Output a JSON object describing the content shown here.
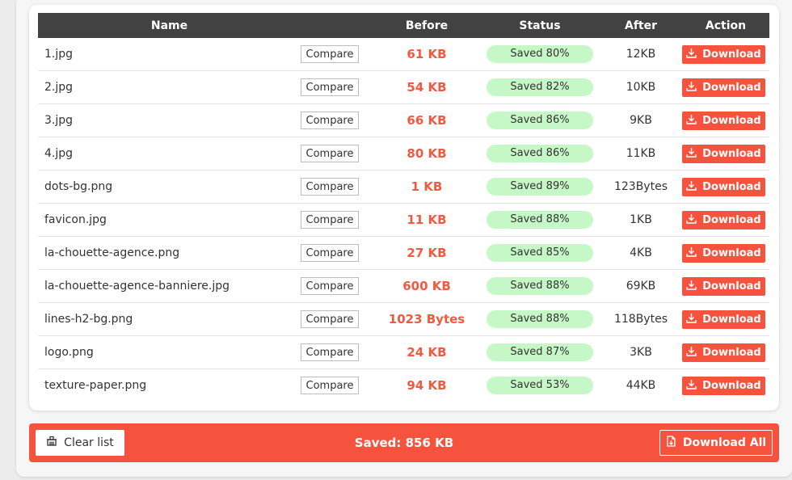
{
  "table": {
    "headers": {
      "name": "Name",
      "before": "Before",
      "status": "Status",
      "after": "After",
      "action": "Action"
    },
    "compare_label": "Compare",
    "download_label": "Download",
    "rows": [
      {
        "name": "1.jpg",
        "before": "61 KB",
        "status": "Saved 80%",
        "after": "12KB"
      },
      {
        "name": "2.jpg",
        "before": "54 KB",
        "status": "Saved 82%",
        "after": "10KB"
      },
      {
        "name": "3.jpg",
        "before": "66 KB",
        "status": "Saved 86%",
        "after": "9KB"
      },
      {
        "name": "4.jpg",
        "before": "80 KB",
        "status": "Saved 86%",
        "after": "11KB"
      },
      {
        "name": "dots-bg.png",
        "before": "1 KB",
        "status": "Saved 89%",
        "after": "123Bytes"
      },
      {
        "name": "favicon.jpg",
        "before": "11 KB",
        "status": "Saved 88%",
        "after": "1KB"
      },
      {
        "name": "la-chouette-agence.png",
        "before": "27 KB",
        "status": "Saved 85%",
        "after": "4KB"
      },
      {
        "name": "la-chouette-agence-banniere.jpg",
        "before": "600 KB",
        "status": "Saved 88%",
        "after": "69KB"
      },
      {
        "name": "lines-h2-bg.png",
        "before": "1023 Bytes",
        "status": "Saved 88%",
        "after": "118Bytes"
      },
      {
        "name": "logo.png",
        "before": "24 KB",
        "status": "Saved 87%",
        "after": "3KB"
      },
      {
        "name": "texture-paper.png",
        "before": "94 KB",
        "status": "Saved 53%",
        "after": "44KB"
      }
    ]
  },
  "footer": {
    "clear_label": "Clear list",
    "saved_total": "Saved: 856 KB",
    "download_all_label": "Download All"
  },
  "colors": {
    "accent": "#f5533d",
    "before_text": "#f05a40",
    "status_pill": "#c6f7c6",
    "header_bg": "#424242"
  },
  "icons": {
    "row_download": "download-icon",
    "clear": "clear-list-icon",
    "download_all": "file-download-icon"
  }
}
